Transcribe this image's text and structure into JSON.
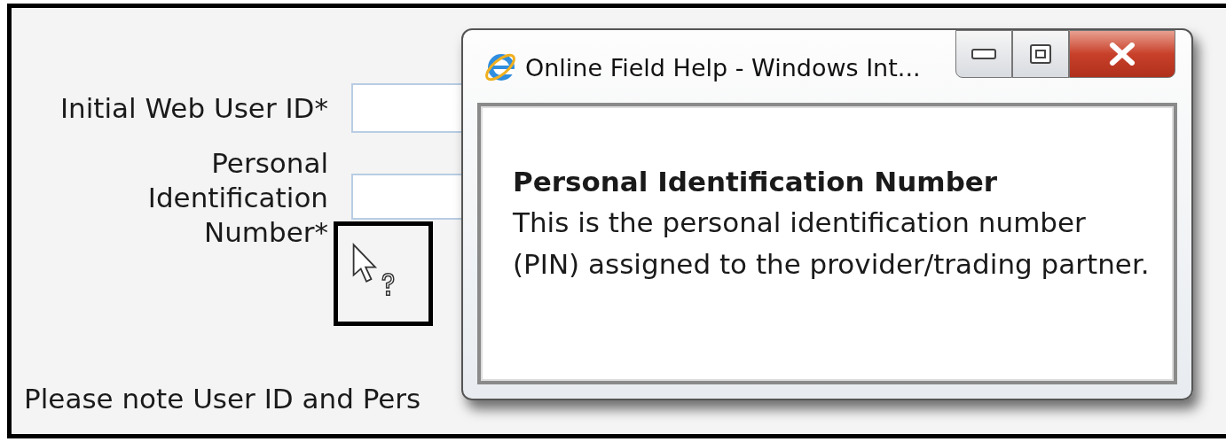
{
  "form": {
    "fields": [
      {
        "label": "Initial Web User ID*"
      },
      {
        "label": "Personal Identification Number*"
      }
    ],
    "note": "Please note User ID and Pers"
  },
  "help_window": {
    "title": "Online Field Help - Windows Int...",
    "heading": "Personal Identification Number",
    "body": "This is the personal identification number (PIN) assigned to the provider/trading partner."
  }
}
